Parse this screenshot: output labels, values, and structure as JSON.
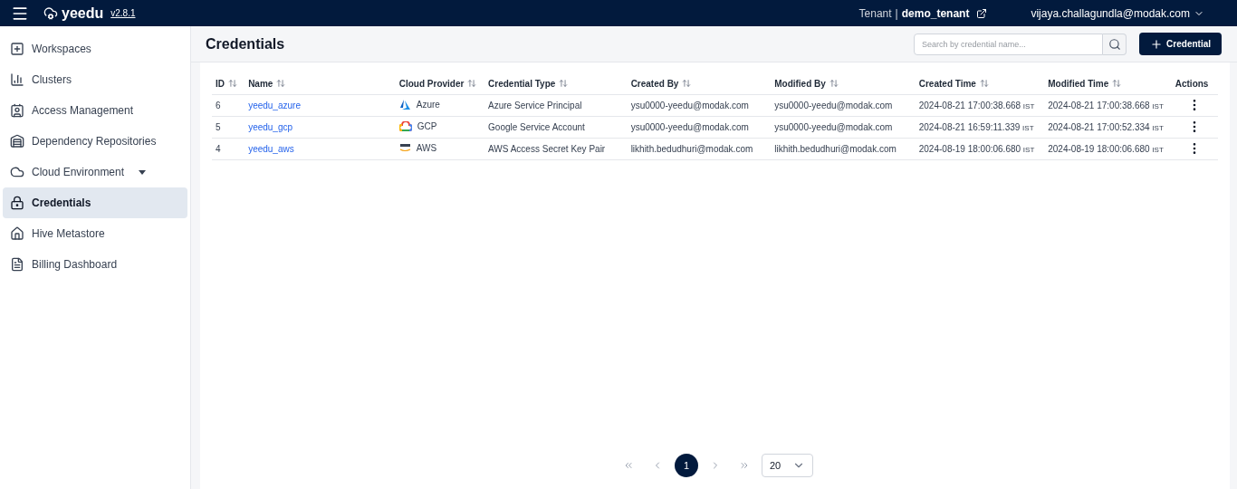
{
  "header": {
    "logo": "yeedu",
    "version": "v2.8.1",
    "tenant_label": "Tenant",
    "separator": "|",
    "tenant": "demo_tenant",
    "user": "vijaya.challagundla@modak.com"
  },
  "sidebar": {
    "items": [
      {
        "label": "Workspaces",
        "selected": false,
        "expandable": false
      },
      {
        "label": "Clusters",
        "selected": false,
        "expandable": false
      },
      {
        "label": "Access Management",
        "selected": false,
        "expandable": false
      },
      {
        "label": "Dependency Repositories",
        "selected": false,
        "expandable": false
      },
      {
        "label": "Cloud Environment",
        "selected": false,
        "expandable": true
      },
      {
        "label": "Credentials",
        "selected": true,
        "expandable": false
      },
      {
        "label": "Hive Metastore",
        "selected": false,
        "expandable": false
      },
      {
        "label": "Billing Dashboard",
        "selected": false,
        "expandable": false
      }
    ]
  },
  "page": {
    "title": "Credentials",
    "search": {
      "placeholder": "Search by credential name..."
    },
    "add_button": "Credential"
  },
  "table": {
    "columns": [
      {
        "label": "ID",
        "sortable": true
      },
      {
        "label": "Name",
        "sortable": true
      },
      {
        "label": "Cloud Provider",
        "sortable": true
      },
      {
        "label": "Credential Type",
        "sortable": true
      },
      {
        "label": "Created By",
        "sortable": true
      },
      {
        "label": "Modified By",
        "sortable": true
      },
      {
        "label": "Created Time",
        "sortable": true
      },
      {
        "label": "Modified Time",
        "sortable": true
      },
      {
        "label": "Actions",
        "sortable": false
      }
    ],
    "rows": [
      {
        "id": "6",
        "name": "yeedu_azure",
        "provider": {
          "kind": "azure",
          "label": "Azure"
        },
        "type": "Azure Service Principal",
        "created_by": "ysu0000-yeedu@modak.com",
        "modified_by": "ysu0000-yeedu@modak.com",
        "created_time": "2024-08-21 17:00:38.668",
        "created_zone": "IST",
        "modified_time": "2024-08-21 17:00:38.668",
        "modified_zone": "IST"
      },
      {
        "id": "5",
        "name": "yeedu_gcp",
        "provider": {
          "kind": "gcp",
          "label": "GCP"
        },
        "type": "Google Service Account",
        "created_by": "ysu0000-yeedu@modak.com",
        "modified_by": "ysu0000-yeedu@modak.com",
        "created_time": "2024-08-21 16:59:11.339",
        "created_zone": "IST",
        "modified_time": "2024-08-21 17:00:52.334",
        "modified_zone": "IST"
      },
      {
        "id": "4",
        "name": "yeedu_aws",
        "provider": {
          "kind": "aws",
          "label": "AWS"
        },
        "type": "AWS Access Secret Key Pair",
        "created_by": "likhith.bedudhuri@modak.com",
        "modified_by": "likhith.bedudhuri@modak.com",
        "created_time": "2024-08-19 18:00:06.680",
        "created_zone": "IST",
        "modified_time": "2024-08-19 18:00:06.680",
        "modified_zone": "IST"
      }
    ]
  },
  "pagination": {
    "pages": [
      {
        "label": "1",
        "selected": true
      }
    ],
    "page_size": "20"
  }
}
